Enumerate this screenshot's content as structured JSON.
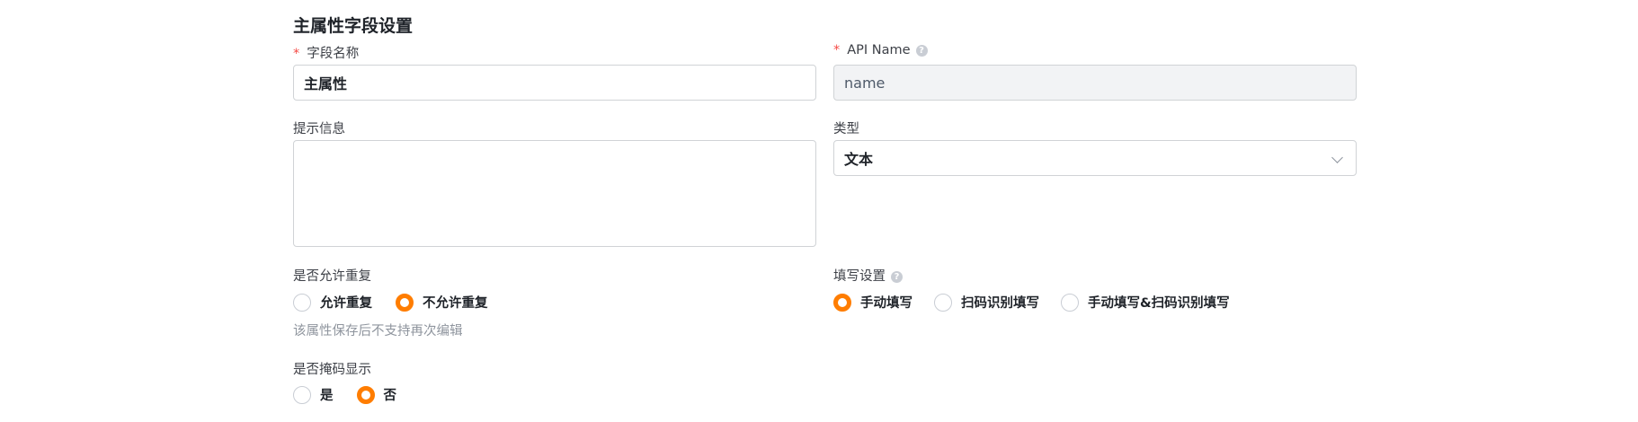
{
  "section_title": "主属性字段设置",
  "field_name": {
    "label": "字段名称",
    "required_mark": "*",
    "value": "主属性"
  },
  "api_name": {
    "label": "API Name",
    "required_mark": "*",
    "value": "name",
    "help_icon": "?"
  },
  "hint_info": {
    "label": "提示信息",
    "value": ""
  },
  "type": {
    "label": "类型",
    "value": "文本"
  },
  "allow_duplicate": {
    "label": "是否允许重复",
    "options": [
      "允许重复",
      "不允许重复"
    ],
    "selected": "不允许重复",
    "note": "该属性保存后不支持再次编辑"
  },
  "fill_setting": {
    "label": "填写设置",
    "help_icon": "?",
    "options": [
      "手动填写",
      "扫码识别填写",
      "手动填写&扫码识别填写"
    ],
    "selected": "手动填写"
  },
  "mask_display": {
    "label": "是否掩码显示",
    "options": [
      "是",
      "否"
    ],
    "selected": "否"
  },
  "colors": {
    "accent": "#ff7d00",
    "required": "#f54a45"
  }
}
